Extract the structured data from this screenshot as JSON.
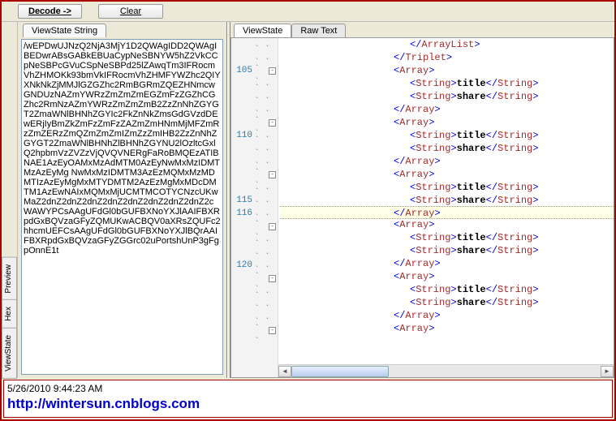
{
  "toolbar": {
    "decode_label": "Decode ->",
    "clear_label": "Clear"
  },
  "side_tabs": [
    "Preview",
    "Hex",
    "ViewState"
  ],
  "left_tab": "ViewState String",
  "right_tabs": [
    "ViewState",
    "Raw Text"
  ],
  "viewstate_string": "/wEPDwUJNzQ2NjA3MjY1D2QWAgIDD2QWAgIBEDwrABsGABkEBUaCypNeSBNYW5hZ2VkCCpNeSBPcGVuCSpNeSBPd25lZAwqTm3IFRocmVhZHMOKk93bmVkIFRocmVhZHMFYWZhc2QIYXNkNkZjMMJlGZGZhc2RmBGRmZQEZHNmcwGNDUzNAZmYWRzZmZmZmEGZmFzZGZhCGZhc2RmNzAZmYWRzZmZmZmB2ZzZnNhZGYGT2ZmaWNlBHNhZGYIc2FkZnNkZmsGdGVzdDEwERjIyBmZkZmFzZmFzZAZmZmHNmMjMFZmRzZmZERzZmQZmZmZmIZmZzZmIHB2ZzZnNhZGYGT2ZmaWNlBHNhZlBHNhZGYNU2lOzltcGxlQ2hpbmVzZVZzVjQVQVNERgFaRoBMQEzATIBNAE1AzEyOAMxMzAdMTM0AzEyNwMxMzIDMTMzAzEyMg NwMxMzIDMTM3AzEzMQMxMzMDMTIzAzEyMgMxMTYDMTM2AzEzMgMxMDcDMTM1AzEwNAIxMQMxMjUCMTMCOTYCNzcUKwMaZ2dnZ2dnZ2dnZ2dnZ2dnZ2dnZ2dnZ2dnZ2cWAWYPCsAAgUFdGl0bGUFBXNoYXJlAAIFBXRpdGxBQVzaGFyZQMUKwACBQV0aXRsZQUFc2hhcmUEFCsAAgUFdGl0bGUFBXNoYXJlBQrAAIFBXRpdGxBQVzaGFyZGGrc02uPortshUnP3gFgpOnnE1t",
  "gutter": [
    {
      "num": "",
      "fold": false,
      "dots": ". ."
    },
    {
      "num": "",
      "fold": false,
      "dots": ". ."
    },
    {
      "num": "105",
      "fold": true,
      "dots": ". ."
    },
    {
      "num": "",
      "fold": false,
      "dots": ". ."
    },
    {
      "num": "",
      "fold": false,
      "dots": ". ."
    },
    {
      "num": "",
      "fold": false,
      "dots": ". ."
    },
    {
      "num": "",
      "fold": true,
      "dots": ". ."
    },
    {
      "num": "110",
      "fold": false,
      "dots": ". ."
    },
    {
      "num": "",
      "fold": false,
      "dots": ". ."
    },
    {
      "num": "",
      "fold": false,
      "dots": ". ."
    },
    {
      "num": "",
      "fold": true,
      "dots": ". ."
    },
    {
      "num": "",
      "fold": false,
      "dots": ". ."
    },
    {
      "num": "115",
      "fold": false,
      "dots": ". ."
    },
    {
      "num": "116",
      "fold": false,
      "dots": ". ."
    },
    {
      "num": "",
      "fold": true,
      "dots": ". ."
    },
    {
      "num": "",
      "fold": false,
      "dots": ". ."
    },
    {
      "num": "",
      "fold": false,
      "dots": ". ."
    },
    {
      "num": "120",
      "fold": false,
      "dots": ". ."
    },
    {
      "num": "",
      "fold": true,
      "dots": ". ."
    },
    {
      "num": "",
      "fold": false,
      "dots": ". ."
    },
    {
      "num": "",
      "fold": false,
      "dots": ". ."
    },
    {
      "num": "",
      "fold": false,
      "dots": ". ."
    },
    {
      "num": "",
      "fold": true,
      "dots": ". ."
    }
  ],
  "code_lines": [
    {
      "indent": "indent0b",
      "type": "close",
      "tag": "ArrayList",
      "sel": false
    },
    {
      "indent": "indent0",
      "type": "close",
      "tag": "Triplet",
      "sel": false
    },
    {
      "indent": "indent0",
      "type": "open",
      "tag": "Array",
      "sel": false
    },
    {
      "indent": "indent0b",
      "type": "pair",
      "tag": "String",
      "text": "title",
      "sel": false
    },
    {
      "indent": "indent0b",
      "type": "pair",
      "tag": "String",
      "text": "share",
      "sel": false
    },
    {
      "indent": "indent0",
      "type": "close",
      "tag": "Array",
      "sel": false
    },
    {
      "indent": "indent0",
      "type": "open",
      "tag": "Array",
      "sel": false
    },
    {
      "indent": "indent0b",
      "type": "pair",
      "tag": "String",
      "text": "title",
      "sel": false
    },
    {
      "indent": "indent0b",
      "type": "pair",
      "tag": "String",
      "text": "share",
      "sel": false
    },
    {
      "indent": "indent0",
      "type": "close",
      "tag": "Array",
      "sel": false
    },
    {
      "indent": "indent0",
      "type": "open",
      "tag": "Array",
      "sel": false
    },
    {
      "indent": "indent0b",
      "type": "pair",
      "tag": "String",
      "text": "title",
      "sel": false
    },
    {
      "indent": "indent0b",
      "type": "pair",
      "tag": "String",
      "text": "share",
      "sel": false
    },
    {
      "indent": "indent0",
      "type": "close",
      "tag": "Array",
      "sel": true
    },
    {
      "indent": "indent0",
      "type": "open",
      "tag": "Array",
      "sel": false
    },
    {
      "indent": "indent0b",
      "type": "pair",
      "tag": "String",
      "text": "title",
      "sel": false
    },
    {
      "indent": "indent0b",
      "type": "pair",
      "tag": "String",
      "text": "share",
      "sel": false
    },
    {
      "indent": "indent0",
      "type": "close",
      "tag": "Array",
      "sel": false
    },
    {
      "indent": "indent0",
      "type": "open",
      "tag": "Array",
      "sel": false
    },
    {
      "indent": "indent0b",
      "type": "pair",
      "tag": "String",
      "text": "title",
      "sel": false
    },
    {
      "indent": "indent0b",
      "type": "pair",
      "tag": "String",
      "text": "share",
      "sel": false
    },
    {
      "indent": "indent0",
      "type": "close",
      "tag": "Array",
      "sel": false
    },
    {
      "indent": "indent0",
      "type": "open",
      "tag": "Array",
      "sel": false
    }
  ],
  "footer": {
    "timestamp": "5/26/2010 9:44:23 AM",
    "url": "http://wintersun.cnblogs.com"
  }
}
